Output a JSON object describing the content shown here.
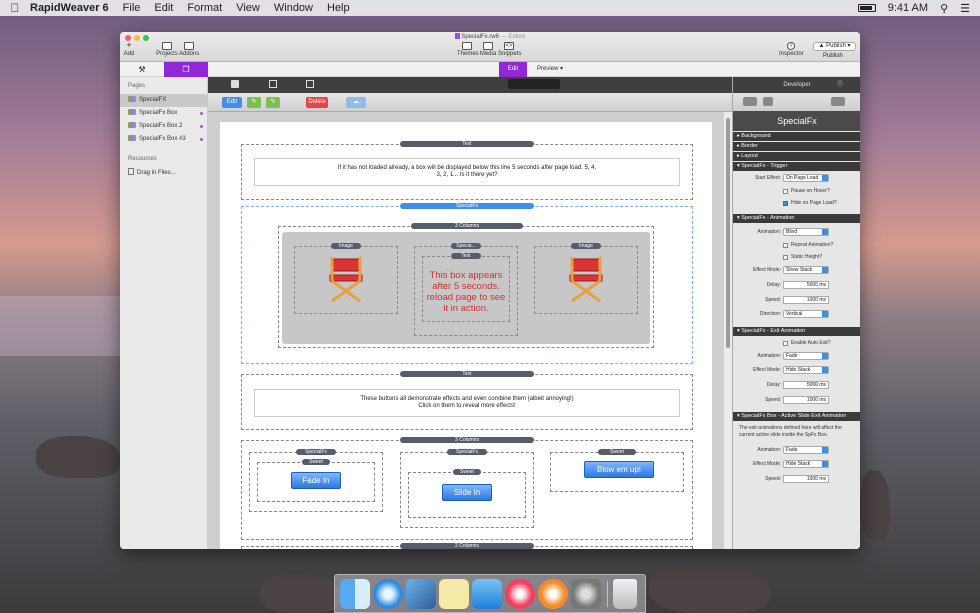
{
  "menubar": {
    "app": "RapidWeaver 6",
    "items": [
      "File",
      "Edit",
      "Format",
      "View",
      "Window",
      "Help"
    ],
    "time": "9:41 AM"
  },
  "window": {
    "title": "SpecialFx.rw6",
    "title_suffix": "— Edited",
    "toolbar_left": [
      {
        "label": "Add",
        "icon": "plus-icon"
      },
      {
        "label": "Projects",
        "icon": "projects-icon"
      },
      {
        "label": "Addons",
        "icon": "addons-icon"
      }
    ],
    "toolbar_center": [
      {
        "label": "Themes",
        "icon": "themes-icon"
      },
      {
        "label": "Media",
        "icon": "media-icon"
      },
      {
        "label": "Snippets",
        "icon": "snippets-icon"
      }
    ],
    "toolbar_right": [
      {
        "label": "Inspector",
        "icon": "info-icon"
      },
      {
        "label": "Publish",
        "icon": "publish-icon"
      }
    ],
    "publish_button": "Publish",
    "edit_tab": "Edit",
    "preview_tab": "Preview"
  },
  "sidebar": {
    "pages_heading": "Pages",
    "pages": [
      {
        "label": "SpecialFX",
        "selected": true
      },
      {
        "label": "SpecialFx Box",
        "selected": false
      },
      {
        "label": "SpecialFx Box 2",
        "selected": false
      },
      {
        "label": "SpecialFx Box #3",
        "selected": false
      }
    ],
    "resources_heading": "Resources",
    "resources_item": "Drag in Files..."
  },
  "editor_toolbar": {
    "edit": "Edit",
    "delete": "Delete"
  },
  "canvas": {
    "text1_tag": "Text",
    "text1_body": "If it has not loaded already, a box will be displayed below this line 5 seconds after page load. 5, 4, 3, 2, 1... Is it there yet?",
    "specialfx_tag": "SpecialFx",
    "columns_tag": "3 Columns",
    "image_tag": "Image",
    "specia_tag": "Specia...",
    "text_tag": "Text",
    "red_text": "This box appears after 5 seconds. reload page to see it in action.",
    "text2_tag": "Text",
    "text2_body": "These buttons all demonstrate effects and even combine them (albeit annoying!) Click on them to reveal more effects!",
    "columns2_tag": "3 Columns",
    "sweet_tag": "Sweet",
    "btn_fade": "Fade In",
    "btn_slide": "Slide In",
    "btn_blow": "Blow em up!",
    "columns3_tag": "2 Columns"
  },
  "inspector": {
    "developer": "Developer",
    "title": "SpecialFx",
    "sections": [
      "Background",
      "Border",
      "Layout",
      "SpecialFx - Trigger"
    ],
    "trigger": {
      "start_effect_label": "Start Effect:",
      "start_effect": "On Page Load",
      "pause_on_hover": "Pause on Hover?",
      "hide_on_load": "Hide on Page Load?"
    },
    "animation_heading": "SpecialFx - Animation",
    "animation": {
      "animation_label": "Animation:",
      "animation": "Blind",
      "repeat": "Repeat Animation?",
      "static_height": "Static Height?",
      "effect_mode_label": "Effect Mode:",
      "effect_mode": "Show Stack",
      "delay_label": "Delay:",
      "delay": "5000 ms",
      "speed_label": "Speed:",
      "speed": "1000 ms",
      "direction_label": "Direction:",
      "direction": "Vertical"
    },
    "exit_heading": "SpecialFx - Exit Animation",
    "exit": {
      "auto_exit": "Enable Auto Exit?",
      "animation_label": "Animation:",
      "animation": "Fade",
      "effect_mode_label": "Effect Mode:",
      "effect_mode": "Hide Stack",
      "delay_label": "Delay:",
      "delay": "5000 ms",
      "speed_label": "Speed:",
      "speed": "1000 ms"
    },
    "box_heading": "SpecialFx Box - Active Slide Exit Animation",
    "box": {
      "note": "The exit animations defined here will affect the current active slide inside the SpFx Box.",
      "animation_label": "Animation:",
      "animation": "Fade",
      "effect_mode_label": "Effect Mode:",
      "effect_mode": "Hide Stack",
      "speed_label": "Speed:",
      "speed": "1000 ms"
    }
  },
  "dock": {
    "apps": [
      "finder-icon",
      "safari-icon",
      "rapidweaver-icon",
      "notes-icon",
      "appstore-icon",
      "itunes-icon",
      "ibooks-icon",
      "system-preferences-icon",
      "trash-icon"
    ]
  }
}
